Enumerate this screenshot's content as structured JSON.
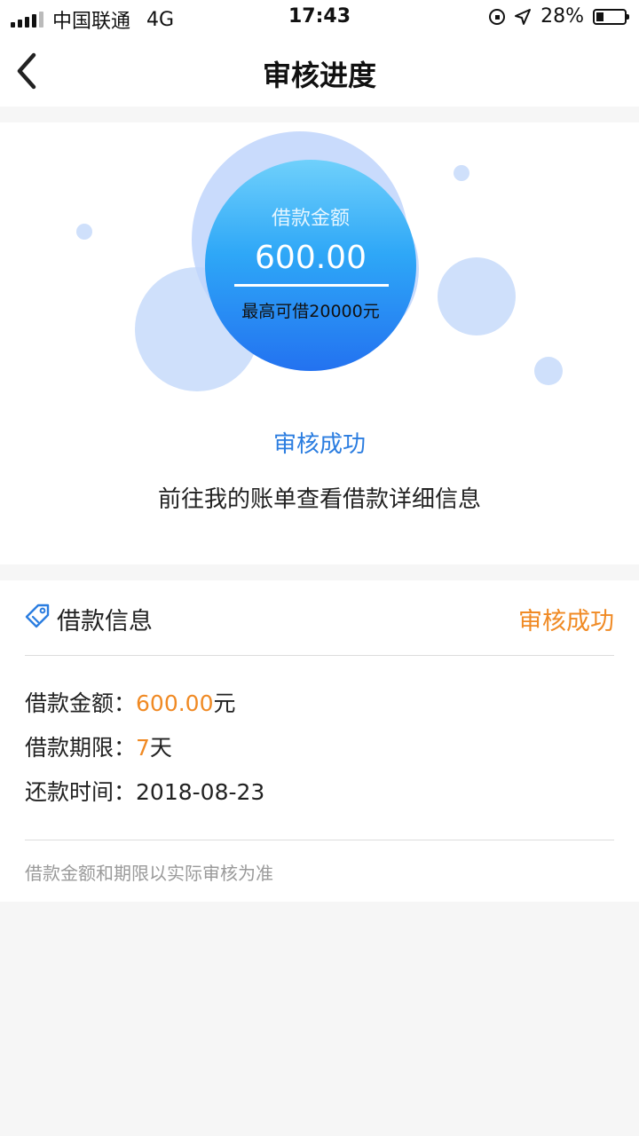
{
  "status_bar": {
    "carrier": "中国联通",
    "network": "4G",
    "time": "17:43",
    "battery_percent": "28%",
    "battery_level": 0.28
  },
  "nav": {
    "back_icon": "chevron-left-icon",
    "title": "审核进度"
  },
  "amount_circle": {
    "label": "借款金额",
    "amount": "600.00",
    "max_text": "最高可借20000元"
  },
  "review": {
    "status_title": "审核成功",
    "description": "前往我的账单查看借款详细信息"
  },
  "loan_info": {
    "icon": "tag-icon",
    "title": "借款信息",
    "status": "审核成功",
    "rows": [
      {
        "label": "借款金额：",
        "value": "600.00",
        "unit": "元"
      },
      {
        "label": "借款期限：",
        "value": "7",
        "unit": "天"
      },
      {
        "label": "还款时间：",
        "value": "2018-08-23",
        "unit": ""
      }
    ],
    "note": "借款金额和期限以实际审核为准"
  },
  "colors": {
    "accent_blue": "#2b7de0",
    "accent_orange": "#f08a24",
    "bubble": "#cfe0fb",
    "circle_top": "#6fd0fb",
    "circle_bottom": "#2372f0"
  }
}
